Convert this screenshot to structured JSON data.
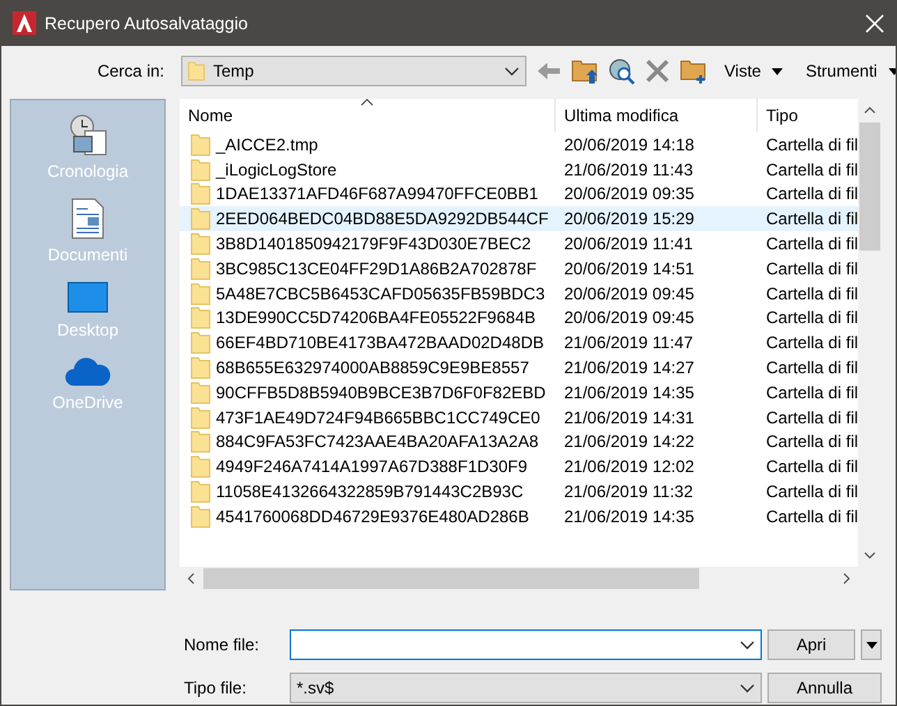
{
  "window": {
    "title": "Recupero Autosalvataggio"
  },
  "toolbar": {
    "look_in_label": "Cerca in:",
    "look_in_value": "Temp",
    "views_label": "Viste",
    "tools_label": "Strumenti"
  },
  "sidebar": {
    "items": [
      {
        "label": "Cronologia",
        "kind": "history",
        "selected": false
      },
      {
        "label": "Documenti",
        "kind": "documents",
        "selected": false
      },
      {
        "label": "Desktop",
        "kind": "desktop",
        "selected": false
      },
      {
        "label": "OneDrive",
        "kind": "cloud",
        "selected": false
      }
    ]
  },
  "table": {
    "columns": [
      "Nome",
      "Ultima modifica",
      "Tipo"
    ],
    "rows": [
      {
        "name": "_AICCE2.tmp",
        "modified": "20/06/2019 14:18",
        "type": "Cartella di fil",
        "selected": false
      },
      {
        "name": "_iLogicLogStore",
        "modified": "21/06/2019 11:43",
        "type": "Cartella di fil",
        "selected": false
      },
      {
        "name": "1DAE13371AFD46F687A99470FFCE0BB1",
        "modified": "20/06/2019 09:35",
        "type": "Cartella di fil",
        "selected": false
      },
      {
        "name": "2EED064BEDC04BD88E5DA9292DB544CF",
        "modified": "20/06/2019 15:29",
        "type": "Cartella di fil",
        "selected": true
      },
      {
        "name": "3B8D1401850942179F9F43D030E7BEC2",
        "modified": "20/06/2019 11:41",
        "type": "Cartella di fil",
        "selected": false
      },
      {
        "name": "3BC985C13CE04FF29D1A86B2A702878F",
        "modified": "20/06/2019 14:51",
        "type": "Cartella di fil",
        "selected": false
      },
      {
        "name": "5A48E7CBC5B6453CAFD05635FB59BDC3",
        "modified": "20/06/2019 09:45",
        "type": "Cartella di fil",
        "selected": false
      },
      {
        "name": "13DE990CC5D74206BA4FE05522F9684B",
        "modified": "20/06/2019 09:45",
        "type": "Cartella di fil",
        "selected": false
      },
      {
        "name": "66EF4BD710BE4173BA472BAAD02D48DB",
        "modified": "21/06/2019 11:47",
        "type": "Cartella di fil",
        "selected": false
      },
      {
        "name": "68B655E632974000AB8859C9E9BE8557",
        "modified": "21/06/2019 14:27",
        "type": "Cartella di fil",
        "selected": false
      },
      {
        "name": "90CFFB5D8B5940B9BCE3B7D6F0F82EBD",
        "modified": "21/06/2019 14:35",
        "type": "Cartella di fil",
        "selected": false
      },
      {
        "name": "473F1AE49D724F94B665BBC1CC749CE0",
        "modified": "21/06/2019 14:31",
        "type": "Cartella di fil",
        "selected": false
      },
      {
        "name": "884C9FA53FC7423AAE4BA20AFA13A2A8",
        "modified": "21/06/2019 14:22",
        "type": "Cartella di fil",
        "selected": false
      },
      {
        "name": "4949F246A7414A1997A67D388F1D30F9",
        "modified": "21/06/2019 12:02",
        "type": "Cartella di fil",
        "selected": false
      },
      {
        "name": "11058E4132664322859B791443C2B93C",
        "modified": "21/06/2019 11:32",
        "type": "Cartella di fil",
        "selected": false
      },
      {
        "name": "4541760068DD46729E9376E480AD286B",
        "modified": "21/06/2019 14:35",
        "type": "Cartella di fil",
        "selected": false
      }
    ]
  },
  "form": {
    "file_name_label": "Nome file:",
    "file_type_label": "Tipo file:",
    "file_type_value": "*.sv$",
    "open_button": "Apri",
    "cancel_button": "Annulla"
  }
}
